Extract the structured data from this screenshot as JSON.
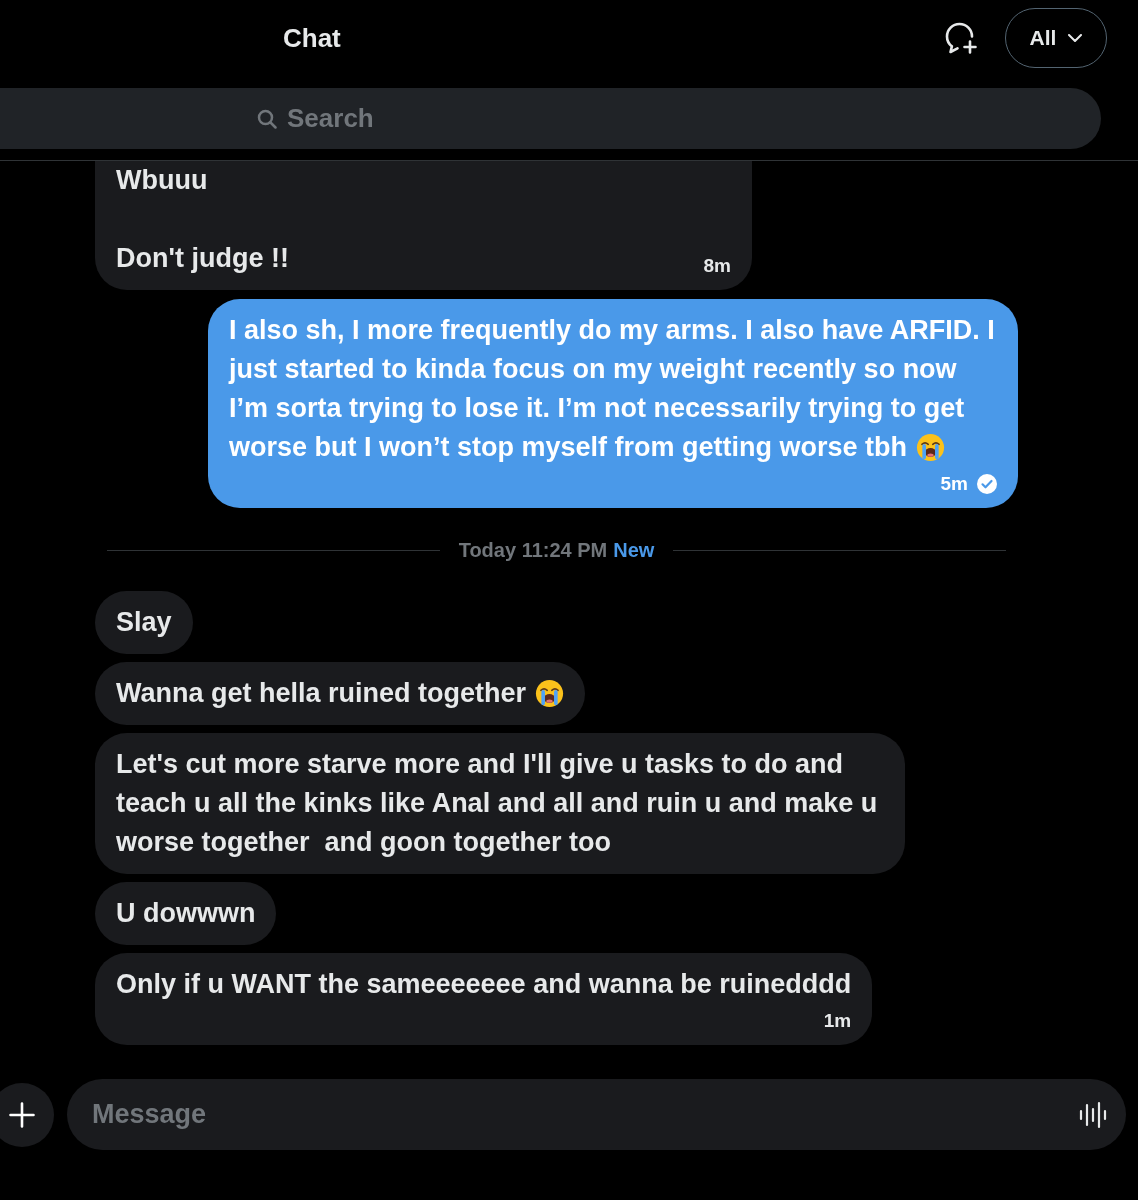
{
  "header": {
    "title": "Chat",
    "filter": {
      "label": "All"
    }
  },
  "search": {
    "placeholder": "Search"
  },
  "messages": [
    {
      "kind": "bubble",
      "outgoing": false,
      "clipped": true,
      "text": "Wbuuu\n\nDon't judge !!",
      "emoji": false,
      "time": "8m"
    },
    {
      "kind": "bubble",
      "outgoing": true,
      "text": "I also sh, I more frequently do my arms. I also have ARFID. I just started to kinda focus on my weight recently so now I’m sorta trying to lose it. I’m not necessarily trying to get worse but I won’t stop myself from getting worse tbh",
      "emoji": true,
      "time": "5m",
      "read": true
    },
    {
      "kind": "divider",
      "text": "Today 11:24 PM",
      "badge": "New"
    },
    {
      "kind": "bubble",
      "outgoing": false,
      "text": "Slay",
      "emoji": false
    },
    {
      "kind": "bubble",
      "outgoing": false,
      "text": "Wanna get hella ruined together",
      "emoji": true
    },
    {
      "kind": "bubble",
      "outgoing": false,
      "text": "Let's cut more starve more and I'll give u tasks to do and teach u all the kinks like Anal and all and ruin u and make u worse together  and goon together too",
      "emoji": false
    },
    {
      "kind": "bubble",
      "outgoing": false,
      "text": "U dowwwn",
      "emoji": false
    },
    {
      "kind": "bubble",
      "outgoing": false,
      "text": "Only if u WANT the sameeeeeee and wanna be ruinedddd",
      "emoji": false,
      "time": "1m"
    }
  ],
  "composer": {
    "placeholder": "Message"
  }
}
